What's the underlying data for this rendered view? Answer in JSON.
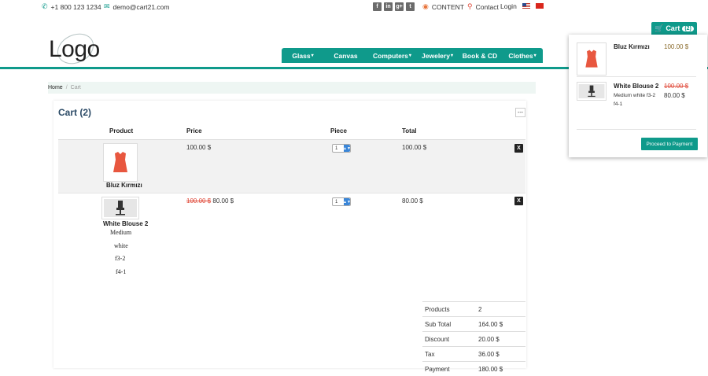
{
  "topbar": {
    "phone": "+1 800 123 1234",
    "email": "demo@cart21.com",
    "social": [
      "f",
      "in",
      "g+",
      "t"
    ],
    "content_label": "CONTENT",
    "contact_label": "Contact",
    "login_label": "Login"
  },
  "header": {
    "logo": "Logo",
    "nav": [
      {
        "label": "Glass",
        "caret": "▾"
      },
      {
        "label": "Canvas",
        "caret": ""
      },
      {
        "label": "Computers",
        "caret": "▾"
      },
      {
        "label": "Jewelery",
        "caret": "▾"
      },
      {
        "label": "Book & CD",
        "caret": ""
      },
      {
        "label": "Clothes",
        "caret": "▾"
      }
    ]
  },
  "cart_tab": {
    "label": "Cart",
    "count": "(2)"
  },
  "breadcrumb": {
    "home": "Home",
    "sep": "/",
    "current": "Cart"
  },
  "cart": {
    "title": "Cart (2)",
    "min_label": "---",
    "columns": {
      "product": "Product",
      "price": "Price",
      "piece": "Piece",
      "total": "Total"
    },
    "items": [
      {
        "name": "Bluz Kırmızı",
        "price": "100.00 $",
        "qty": "1",
        "total": "100.00 $",
        "delete": "X"
      },
      {
        "name": "White Blouse 2",
        "old_price": "100.00 $",
        "price": "80.00 $",
        "qty": "1",
        "total": "80.00 $",
        "delete": "X",
        "variants": [
          "Medium",
          "white",
          "f3-2",
          "f4-1"
        ]
      }
    ]
  },
  "summary": [
    {
      "k": "Products",
      "v": "2"
    },
    {
      "k": "Sub Total",
      "v": "164.00 $"
    },
    {
      "k": "Discount",
      "v": "20.00 $"
    },
    {
      "k": "Tax",
      "v": "36.00 $"
    },
    {
      "k": "Payment",
      "v": "180.00 $"
    }
  ],
  "mini_cart": {
    "items": [
      {
        "name": "Bluz Kırmızı",
        "price": "100.00 $"
      },
      {
        "name": "White Blouse 2",
        "old_price": "100.00 $",
        "price": "80.00 $",
        "variant_line1": "Medium white f3-2",
        "variant_line2": "f4-1"
      }
    ],
    "proceed_label": "Proceed to Payment"
  },
  "colors": {
    "accent": "#0f9a8b",
    "strike": "#e04a3a",
    "title": "#2b4a66"
  }
}
